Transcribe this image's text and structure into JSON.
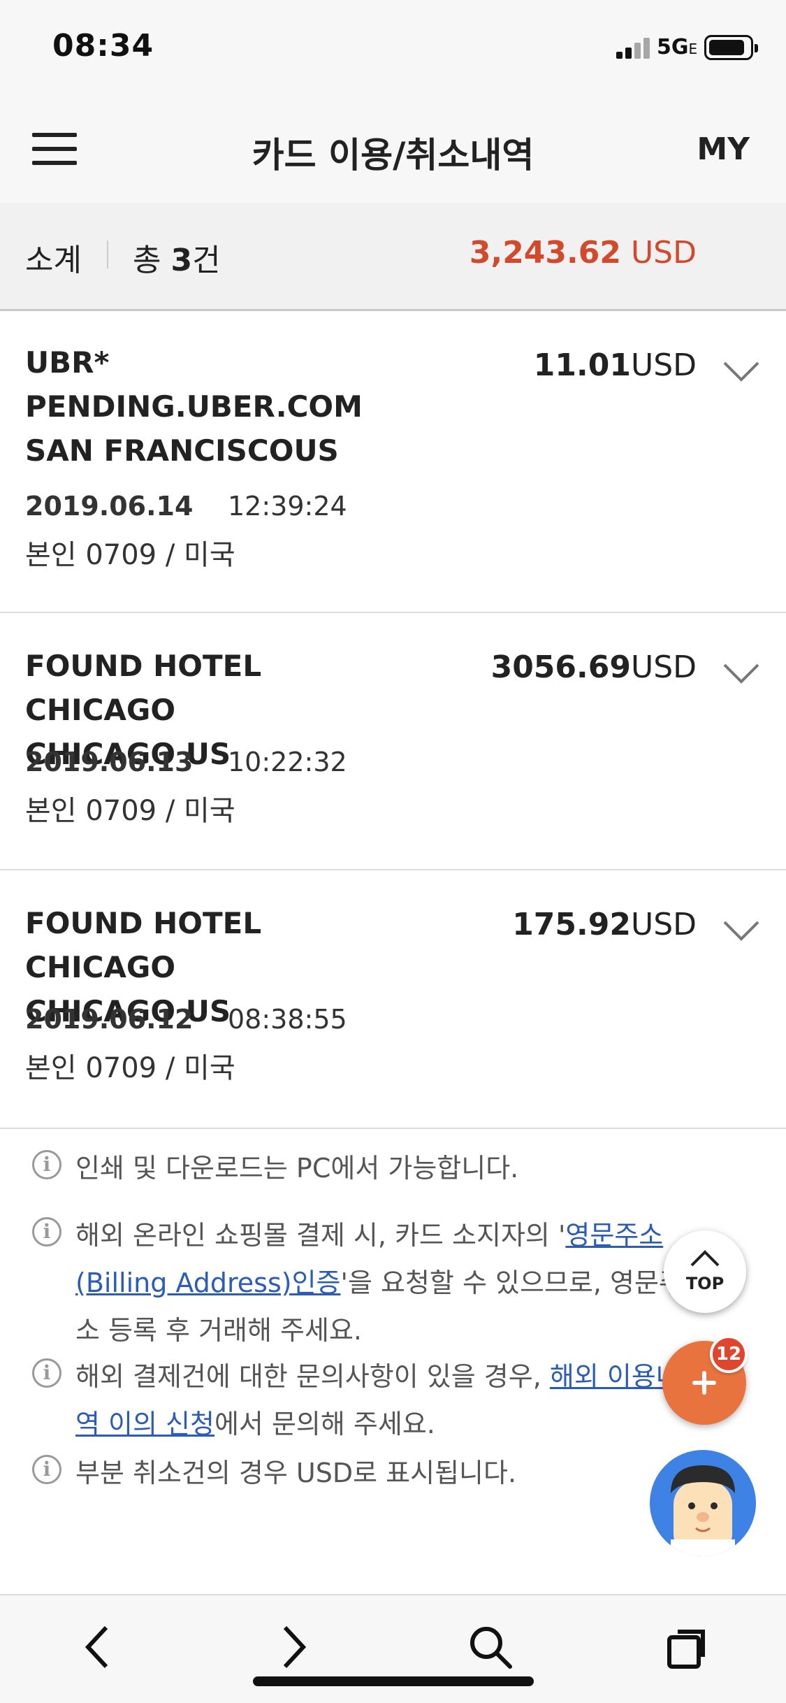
{
  "status_bar": {
    "time": "08:34",
    "network": "5G",
    "network_suffix": "E"
  },
  "header": {
    "title": "카드 이용/취소내역",
    "my_label": "MY"
  },
  "summary": {
    "label": "소계",
    "count_prefix": "총 ",
    "count_value": "3",
    "count_suffix": "건",
    "total_amount": "3,243.62",
    "total_currency": " USD"
  },
  "transactions": [
    {
      "merchant_lines": [
        "UBR*",
        "PENDING.UBER.COM",
        "SAN FRANCISCOUS"
      ],
      "date": "2019.06.14",
      "time": "12:39:24",
      "holder": "본인 0709 / 미국",
      "amount": "11.01",
      "currency": "USD"
    },
    {
      "merchant_lines": [
        "FOUND HOTEL CHICAGO",
        "CHICAGO US"
      ],
      "date": "2019.06.13",
      "time": "10:22:32",
      "holder": "본인 0709 / 미국",
      "amount": "3056.69",
      "currency": "USD"
    },
    {
      "merchant_lines": [
        "FOUND HOTEL CHICAGO",
        "CHICAGO US"
      ],
      "date": "2019.06.12",
      "time": "08:38:55",
      "holder": "본인 0709 / 미국",
      "amount": "175.92",
      "currency": "USD"
    }
  ],
  "notes": [
    {
      "text": "인쇄 및 다운로드는 PC에서 가능합니다."
    },
    {
      "text_before": "해외 온라인 쇼핑몰 결제 시, 카드 소지자의 '",
      "link": "영문주소(Billing Address)인증",
      "text_after": "'을 요청할 수 있으므로, 영문주소 등록 후 거래해 주세요."
    },
    {
      "text_before": "해외 결제건에 대한 문의사항이 있을 경우, ",
      "link": "해외 이용내역 이의 신청",
      "text_after": "에서 문의해 주세요."
    },
    {
      "text": "부분 취소건의 경우 USD로 표시됩니다."
    }
  ],
  "floating": {
    "top_label": "TOP",
    "badge_count": "12"
  },
  "colors": {
    "accent": "#d3492c",
    "fab": "#e8733e",
    "link": "#2a5cb8",
    "chatbot_bg": "#3e82e6"
  }
}
